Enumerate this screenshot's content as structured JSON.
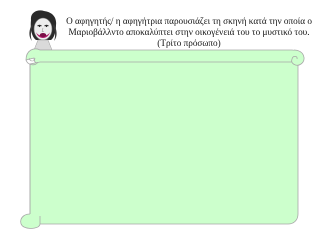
{
  "caption": {
    "line1": "Ο αφηγητής/ η αφηγήτρια παρουσιάζει τη σκηνή κατά την οποία ο",
    "line2": "Μαριοβάλλντο αποκαλύπτει στην οικογένειά του το μυστικό του.",
    "line3": "(Τρίτο πρόσωπο)"
  },
  "colors": {
    "scroll_fill": "#CCFFCC",
    "scroll_outline": "#A8A8A8",
    "hair": "#2A2A2A",
    "skin": "#E9E9E9",
    "mask_mouth": "#B0186A"
  },
  "icons": {
    "avatar": "drama-mask-narrator-icon",
    "scroll": "parchment-scroll"
  }
}
